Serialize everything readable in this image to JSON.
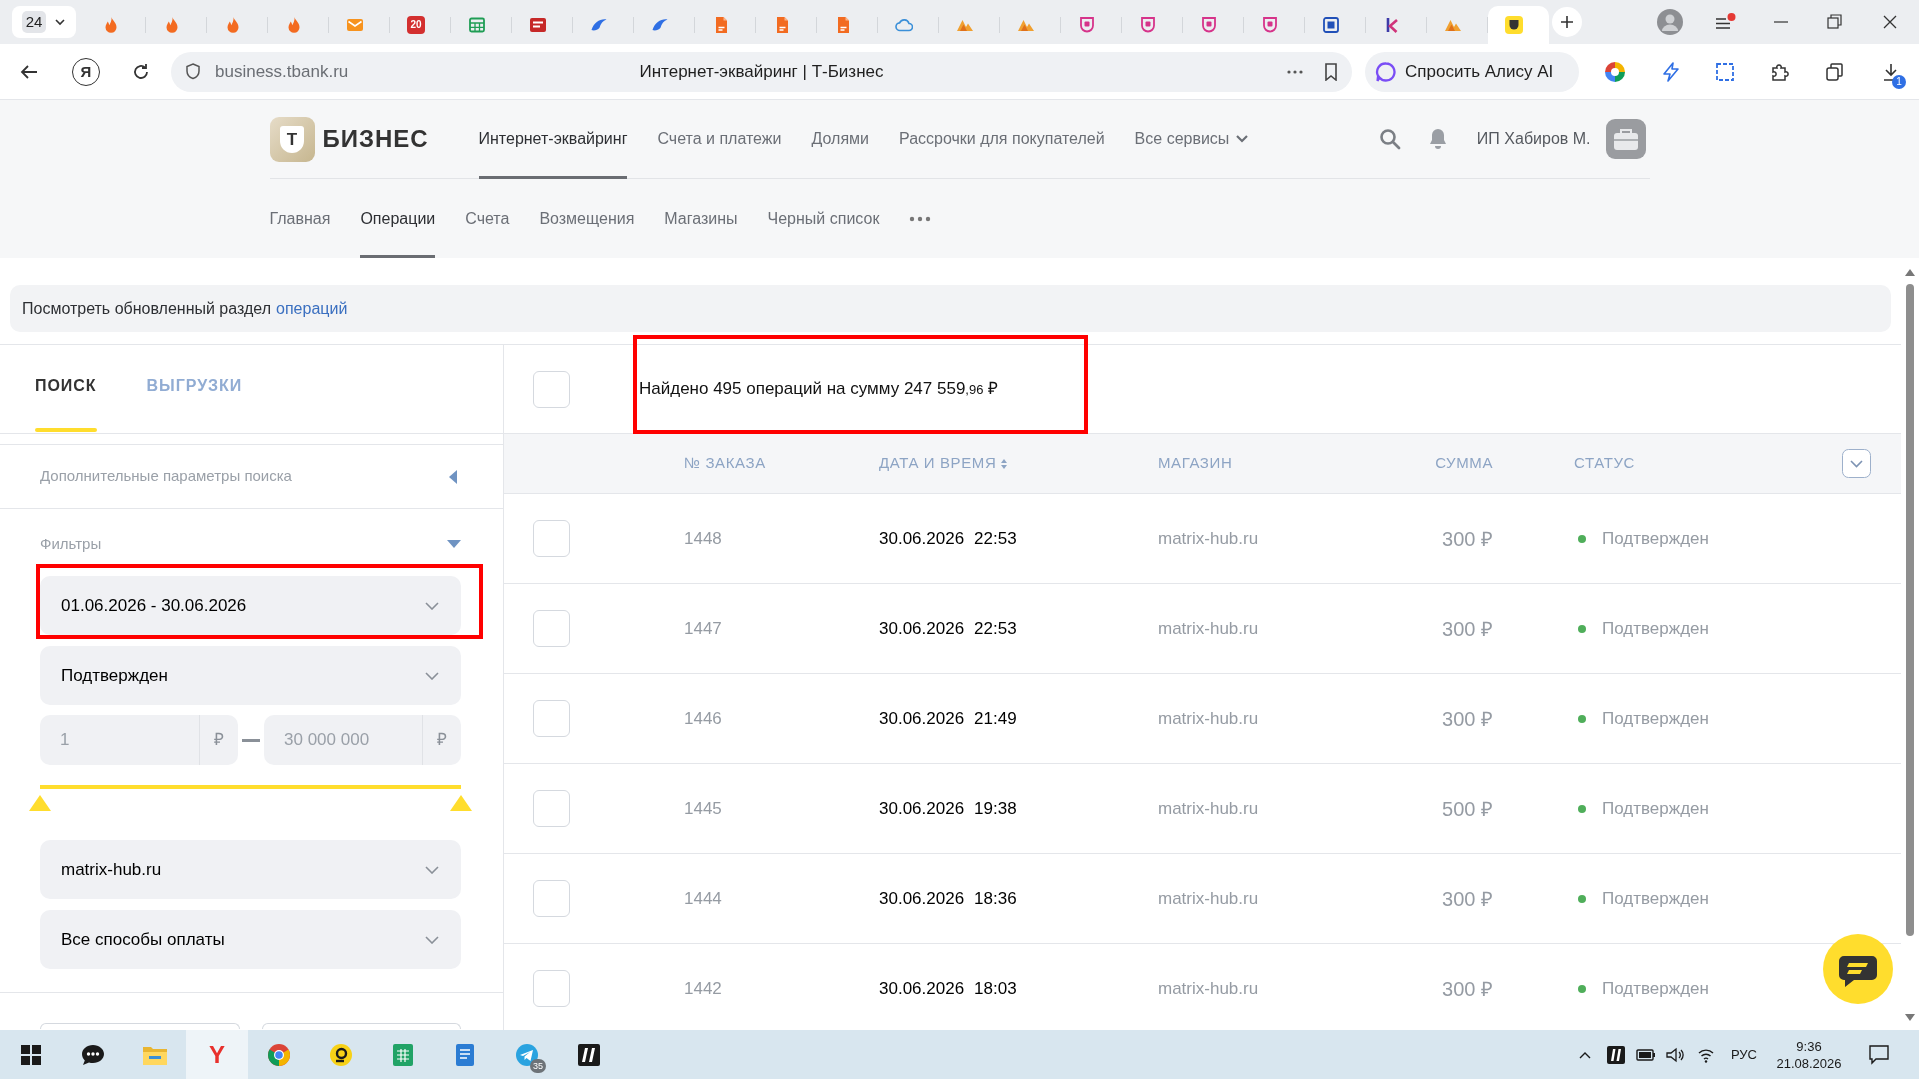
{
  "browser": {
    "tab_count": "24",
    "tabs": [
      {
        "kind": "flame",
        "selected": false
      },
      {
        "kind": "flame",
        "selected": false
      },
      {
        "kind": "flame",
        "selected": false
      },
      {
        "kind": "flame",
        "selected": false
      },
      {
        "kind": "mail",
        "selected": false
      },
      {
        "kind": "badge",
        "badge": "20",
        "selected": false
      },
      {
        "kind": "sheet",
        "selected": false
      },
      {
        "kind": "sd",
        "selected": false
      },
      {
        "kind": "swoosh",
        "selected": false
      },
      {
        "kind": "swoosh",
        "selected": false
      },
      {
        "kind": "pdf",
        "selected": false
      },
      {
        "kind": "pdf",
        "selected": false
      },
      {
        "kind": "pdf",
        "selected": false
      },
      {
        "kind": "cloud",
        "selected": false
      },
      {
        "kind": "pma",
        "selected": false
      },
      {
        "kind": "pma",
        "selected": false
      },
      {
        "kind": "tshield",
        "selected": false
      },
      {
        "kind": "tshield",
        "selected": false
      },
      {
        "kind": "tshield",
        "selected": false
      },
      {
        "kind": "tshield",
        "selected": false
      },
      {
        "kind": "blockdoc",
        "selected": false
      },
      {
        "kind": "k",
        "selected": false
      },
      {
        "kind": "pma",
        "selected": false
      },
      {
        "kind": "tyellow",
        "selected": true
      }
    ],
    "address": {
      "url": "business.tbank.ru",
      "title": "Интернет-эквайринг | Т-Бизнес"
    },
    "home_glyph": "Я",
    "alice_button": "Спросить Алису AI",
    "downloads_badge": "1"
  },
  "header": {
    "logo_mark": "Т",
    "logo_text": "БИЗНЕС",
    "nav": [
      {
        "label": "Интернет-эквайринг",
        "selected": true,
        "dropdown": false
      },
      {
        "label": "Счета и платежи",
        "selected": false,
        "dropdown": false
      },
      {
        "label": "Долями",
        "selected": false,
        "dropdown": false
      },
      {
        "label": "Рассрочки для покупателей",
        "selected": false,
        "dropdown": false
      },
      {
        "label": "Все сервисы",
        "selected": false,
        "dropdown": true
      }
    ],
    "user_name": "ИП Хабиров М."
  },
  "subnav": [
    {
      "label": "Главная",
      "selected": false
    },
    {
      "label": "Операции",
      "selected": true
    },
    {
      "label": "Счета",
      "selected": false
    },
    {
      "label": "Возмещения",
      "selected": false
    },
    {
      "label": "Магазины",
      "selected": false
    },
    {
      "label": "Черный список",
      "selected": false
    }
  ],
  "notice": {
    "text": "Посмотреть обновленный раздел",
    "link": "операций"
  },
  "search_panel": {
    "tabs": [
      {
        "label": "ПОИСК",
        "selected": true
      },
      {
        "label": "ВЫГРУЗКИ",
        "selected": false
      }
    ],
    "advanced": {
      "label": "Дополнительные параметры поиска",
      "expanded": false
    },
    "filters": {
      "label": "Фильтры",
      "expanded": true,
      "items": [
        {
          "kind": "select",
          "value": "01.06.2026 - 30.06.2026",
          "highlighted": true
        },
        {
          "kind": "select",
          "value": "Подтвержден",
          "highlighted": false
        },
        {
          "kind": "range",
          "from": {
            "placeholder": "1",
            "currency": "₽"
          },
          "to": {
            "placeholder": "30 000 000",
            "currency": "₽"
          }
        },
        {
          "kind": "slider",
          "thumbs": [
            {
              "level": 0
            },
            {
              "level": 1
            }
          ]
        },
        {
          "kind": "select",
          "value": "matrix-hub.ru",
          "highlighted": false
        },
        {
          "kind": "select",
          "value": "Все способы оплаты",
          "highlighted": false
        }
      ]
    }
  },
  "operations": {
    "summary": {
      "checked": false,
      "text": "Найдено 495 операций на сумму 247 559",
      "fraction": ",96",
      "currency": "₽",
      "highlighted": true
    },
    "columns": [
      {
        "label": "№ ЗАКАЗА",
        "sortable": false
      },
      {
        "label": "ДАТА И ВРЕМЯ",
        "sortable": true
      },
      {
        "label": "МАГАЗИН",
        "sortable": false
      },
      {
        "label": "СУММА",
        "sortable": false
      },
      {
        "label": "СТАТУС",
        "sortable": false
      }
    ],
    "rows": [
      {
        "checked": false,
        "order": "1448",
        "date": "30.06.2026",
        "time": "22:53",
        "store": "matrix-hub.ru",
        "amount": "300 ₽",
        "status": "Подтвержден",
        "color": "#4fae5a"
      },
      {
        "checked": false,
        "order": "1447",
        "date": "30.06.2026",
        "time": "22:53",
        "store": "matrix-hub.ru",
        "amount": "300 ₽",
        "status": "Подтвержден",
        "color": "#4fae5a"
      },
      {
        "checked": false,
        "order": "1446",
        "date": "30.06.2026",
        "time": "21:49",
        "store": "matrix-hub.ru",
        "amount": "300 ₽",
        "status": "Подтвержден",
        "color": "#4fae5a"
      },
      {
        "checked": false,
        "order": "1445",
        "date": "30.06.2026",
        "time": "19:38",
        "store": "matrix-hub.ru",
        "amount": "500 ₽",
        "status": "Подтвержден",
        "color": "#4fae5a"
      },
      {
        "checked": false,
        "order": "1444",
        "date": "30.06.2026",
        "time": "18:36",
        "store": "matrix-hub.ru",
        "amount": "300 ₽",
        "status": "Подтвержден",
        "color": "#4fae5a"
      },
      {
        "checked": false,
        "order": "1442",
        "date": "30.06.2026",
        "time": "18:03",
        "store": "matrix-hub.ru",
        "amount": "300 ₽",
        "status": "Подтвержден",
        "color": "#4fae5a"
      }
    ]
  },
  "taskbar": {
    "apps": [
      {
        "kind": "start",
        "selected": false
      },
      {
        "kind": "chat",
        "selected": false
      },
      {
        "kind": "folder",
        "selected": false
      },
      {
        "kind": "yandex",
        "glyph": "Y",
        "selected": true
      },
      {
        "kind": "chrome",
        "selected": false
      },
      {
        "kind": "ring",
        "selected": false
      },
      {
        "kind": "sheet",
        "selected": false
      },
      {
        "kind": "doc",
        "selected": false
      },
      {
        "kind": "telegram",
        "badge": "35",
        "selected": false
      },
      {
        "kind": "hlogo",
        "selected": false
      }
    ],
    "tray": {
      "language": "РУС",
      "time": "9:36",
      "date": "21.08.2026"
    }
  }
}
